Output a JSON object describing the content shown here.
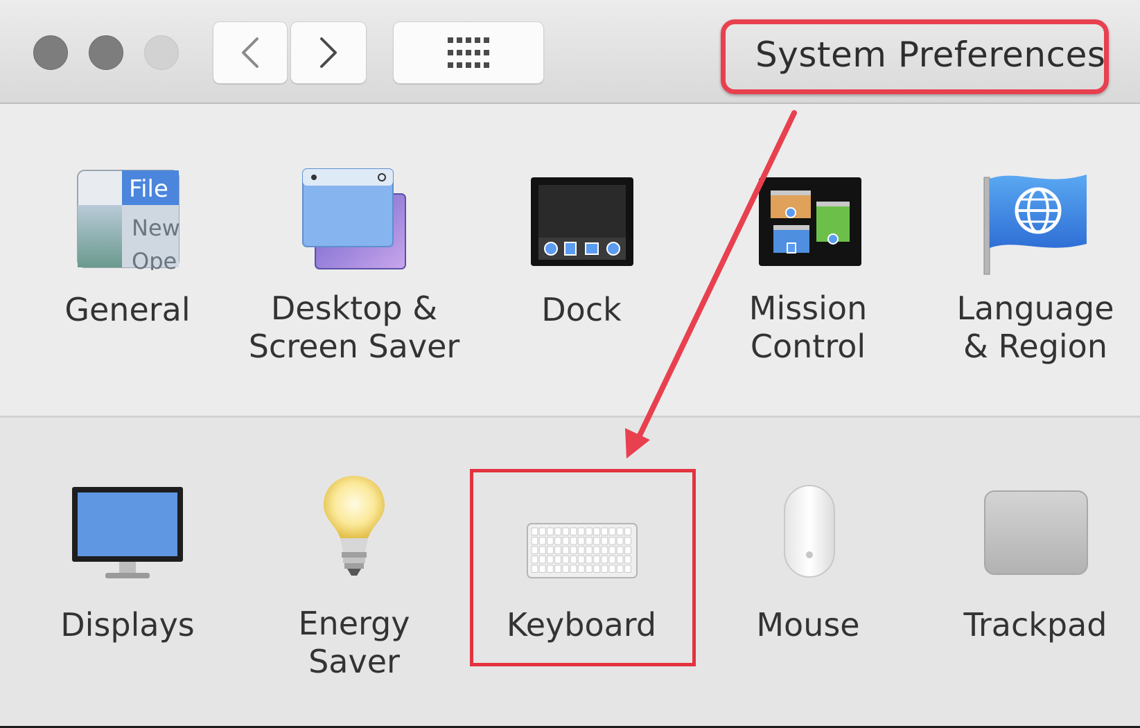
{
  "window": {
    "title": "System Preferences"
  },
  "toolbar": {
    "back_icon": "chevron-left-icon",
    "forward_icon": "chevron-right-icon",
    "show_all_icon": "grid-icon"
  },
  "preferences": {
    "general": {
      "label": "General",
      "icon_text": "File",
      "icon_lines": [
        "New",
        "Ope"
      ]
    },
    "desktop": {
      "label": "Desktop &\nScreen Saver"
    },
    "dock": {
      "label": "Dock"
    },
    "mission": {
      "label": "Mission\nControl"
    },
    "language": {
      "label": "Language\n& Region"
    },
    "displays": {
      "label": "Displays"
    },
    "energy": {
      "label": "Energy\nSaver"
    },
    "keyboard": {
      "label": "Keyboard"
    },
    "mouse": {
      "label": "Mouse"
    },
    "trackpad": {
      "label": "Trackpad"
    }
  },
  "annotations": {
    "highlight_color": "#e8404f"
  }
}
